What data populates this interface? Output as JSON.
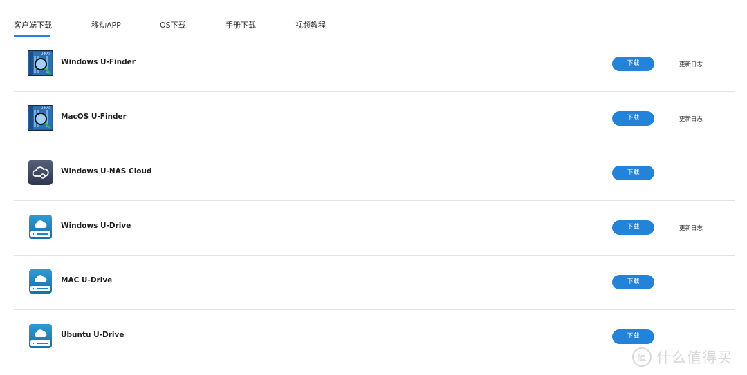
{
  "tabs": [
    {
      "label": "客户端下载",
      "active": true
    },
    {
      "label": "移动APP",
      "active": false
    },
    {
      "label": "OS下载",
      "active": false
    },
    {
      "label": "手册下载",
      "active": false
    },
    {
      "label": "视频教程",
      "active": false
    }
  ],
  "rows": [
    {
      "title": "Windows U-Finder",
      "icon": "u-finder-icon",
      "icon_text": "U-NAS",
      "button": "下载",
      "changelog": "更新日志"
    },
    {
      "title": "MacOS U-Finder",
      "icon": "u-finder-icon",
      "icon_text": "U-NAS",
      "button": "下载",
      "changelog": "更新日志"
    },
    {
      "title": "Windows U-NAS Cloud",
      "icon": "u-nas-cloud-icon",
      "button": "下载"
    },
    {
      "title": "Windows U-Drive",
      "icon": "u-drive-icon",
      "button": "下载",
      "changelog": "更新日志"
    },
    {
      "title": "MAC U-Drive",
      "icon": "u-drive-icon",
      "button": "下载"
    },
    {
      "title": "Ubuntu U-Drive",
      "icon": "u-drive-icon",
      "button": "下载"
    }
  ],
  "watermark": {
    "text": "什么值得买",
    "logo_text": "值"
  },
  "colors": {
    "accent": "#2283d8",
    "divider": "#e2e2e2",
    "finder_icon": "#2d6fb3",
    "cloud_icon": "#3d4a63",
    "drive_icon": "#1f84c4"
  }
}
